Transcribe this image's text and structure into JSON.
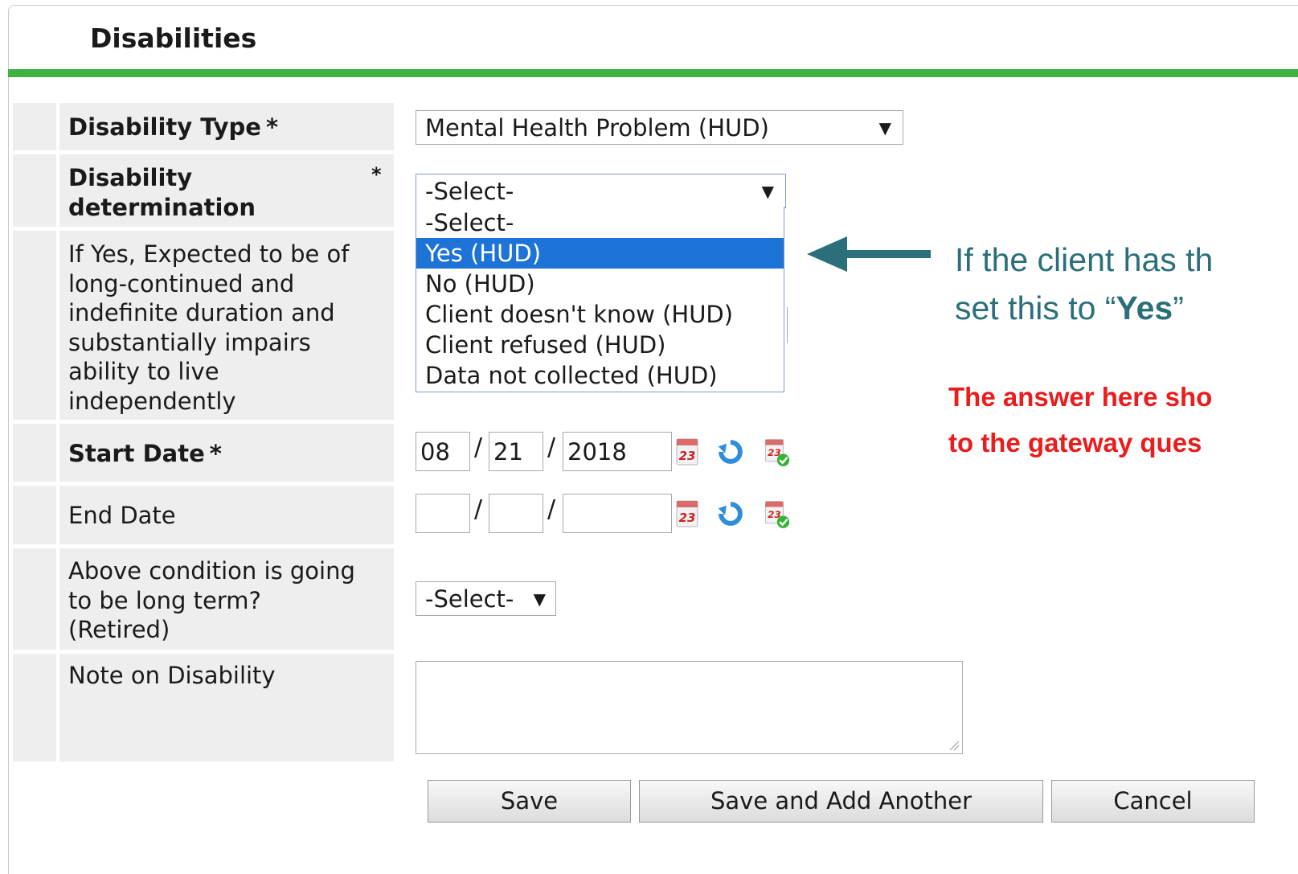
{
  "panel": {
    "title": "Disabilities"
  },
  "fields": {
    "disability_type": {
      "label": "Disability Type",
      "required_mark": "*",
      "value": "Mental Health Problem (HUD)"
    },
    "disability_determination": {
      "label_line1": "Disability",
      "label_line2": "determination",
      "required_mark": "*",
      "value": "-Select-",
      "options": [
        "-Select-",
        "Yes (HUD)",
        "No (HUD)",
        "Client doesn't know (HUD)",
        "Client refused (HUD)",
        "Data not collected (HUD)"
      ],
      "highlighted_option": "Yes (HUD)"
    },
    "expected_long_continued": {
      "label_lines": [
        "If Yes, Expected to be of",
        "long-continued and",
        "indefinite duration and",
        "substantially impairs",
        "ability to live",
        "independently"
      ]
    },
    "start_date": {
      "label": "Start Date",
      "required_mark": "*",
      "month": "08",
      "day": "21",
      "year": "2018",
      "separator": "/"
    },
    "end_date": {
      "label": "End Date",
      "month": "",
      "day": "",
      "year": "",
      "separator": "/"
    },
    "long_term_retired": {
      "label_lines": [
        "Above condition is going",
        "to be long term?",
        "(Retired)"
      ],
      "value": "-Select-"
    },
    "note": {
      "label": "Note on Disability",
      "value": ""
    }
  },
  "buttons": {
    "save": "Save",
    "save_add_another": "Save and Add Another",
    "cancel": "Cancel"
  },
  "callout": {
    "line1": "If the client has th",
    "line2_prefix": "set this to “",
    "line2_bold": "Yes",
    "line2_suffix": "”",
    "red_line1": "The answer here sho",
    "red_line2": "to the gateway ques"
  },
  "colors": {
    "accent_green": "#3fb13f",
    "selection_blue": "#1e73d6",
    "callout_teal": "#2a6f7a",
    "callout_red": "#ea1c1c"
  },
  "icons": [
    "calendar-icon",
    "refresh-icon",
    "calendar-check-icon"
  ]
}
